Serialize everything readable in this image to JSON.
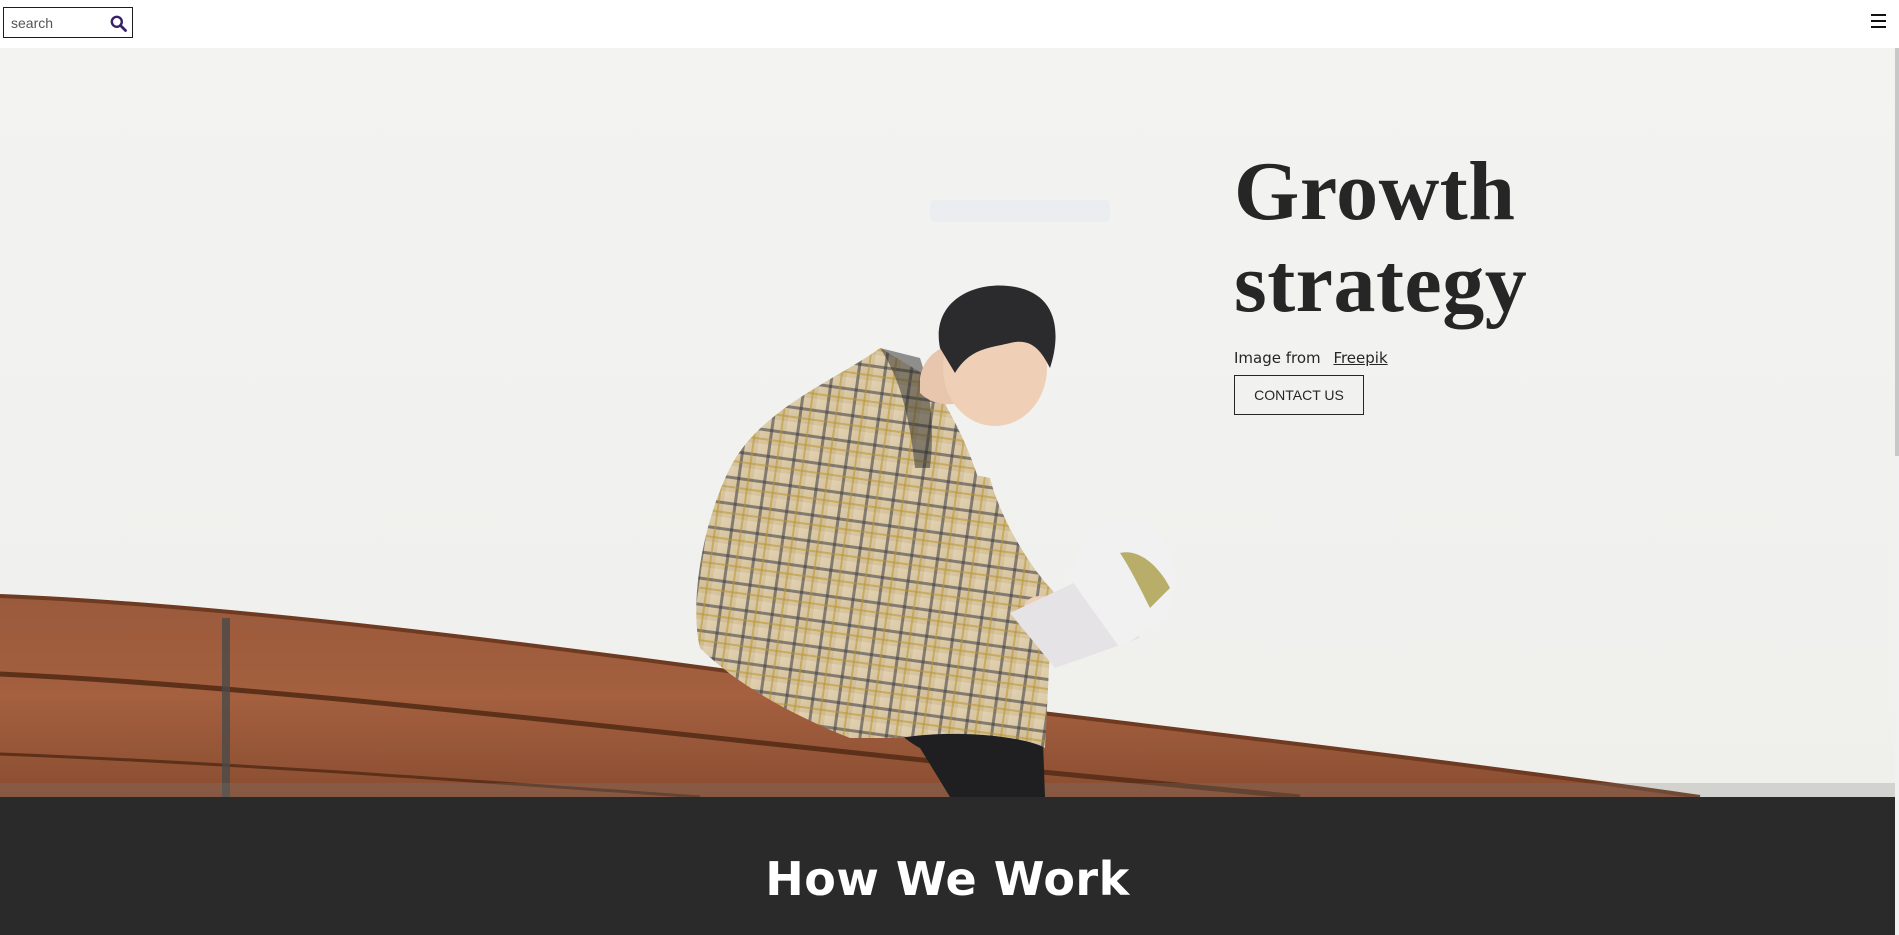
{
  "header": {
    "search": {
      "placeholder": "search",
      "value": "",
      "icon": "search-icon"
    },
    "menu_icon": "hamburger-menu-icon"
  },
  "hero": {
    "title_line1": "Growth",
    "title_line2": "strategy",
    "credit_prefix": "Image from",
    "credit_link": "Freepik",
    "cta_label": "CONTACT US"
  },
  "section": {
    "title": "How We Work"
  },
  "colors": {
    "text_dark": "#262626",
    "section_bg": "#2a2a2a",
    "search_icon": "#3a1f6b",
    "bench_wood": "#a0522d"
  }
}
